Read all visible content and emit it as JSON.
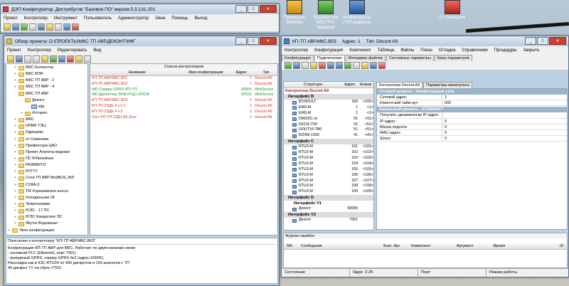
{
  "desktop": {
    "icons": [
      {
        "label": "Проводник Windows",
        "icon": "explorer-icon"
      },
      {
        "label": "Разработчик КИС ГРП-модемов",
        "icon": "modem-developer-icon"
      },
      {
        "label": "Конфигуратор ГРП-модемов",
        "icon": "modem-configurator-icon"
      },
      {
        "label": "С+ Наладчик",
        "icon": "tuner-app-icon"
      }
    ],
    "taskbar_icons": [
      "excel-icon",
      "network-icon",
      "mail-icon",
      "excel-2-icon"
    ]
  },
  "main_window": {
    "title": "ДЭП Конфигуратор. Дистрибутив \"Базовое ПО\" версии 5.5.131.201",
    "menu": [
      "Проект",
      "Контроллер",
      "Инструмент",
      "Пользователь",
      "Администратор",
      "Окна",
      "Помощь",
      "Выход"
    ]
  },
  "project_window": {
    "title": "Обзор проекта: D:\\ПРОЕКТЫ\\МКС ТП АВР.ДЕКОНТ\\КФГ",
    "menu": [
      "Проект",
      "Контроллер",
      "Редактировать",
      "Вид"
    ],
    "tree": [
      {
        "label": "МКС Коллектор",
        "depth": 1,
        "toggle": "+"
      },
      {
        "label": "МКС МЭК",
        "depth": 1,
        "toggle": "+"
      },
      {
        "label": "МКС ТП АВР - 2",
        "depth": 1,
        "toggle": "+"
      },
      {
        "label": "МКС ТП АВР - 4",
        "depth": 1,
        "toggle": "+"
      },
      {
        "label": "МКС ТП АВР",
        "depth": 1,
        "toggle": "-"
      },
      {
        "label": "Деконт",
        "depth": 2,
        "toggle": "-"
      },
      {
        "label": "кфг",
        "depth": 3,
        "toggle": ""
      },
      {
        "label": "История",
        "depth": 2,
        "toggle": "+"
      },
      {
        "label": "МКС",
        "depth": 1,
        "toggle": "+"
      },
      {
        "label": "НПМК ТЭЦ",
        "depth": 1,
        "toggle": "+"
      },
      {
        "label": "Одинцово",
        "depth": 1,
        "toggle": "+"
      },
      {
        "label": "от Семенова",
        "depth": 1,
        "toggle": "+"
      },
      {
        "label": "Префектура ЦАО",
        "depth": 1,
        "toggle": "+"
      },
      {
        "label": "Проект Апатиты водокан",
        "depth": 1,
        "toggle": "+"
      },
      {
        "label": "ПС Юбилейная",
        "depth": 1,
        "toggle": "+"
      },
      {
        "label": "РАЗМЕРГО",
        "depth": 1,
        "toggle": "+"
      },
      {
        "label": "РХТТУ",
        "depth": 1,
        "toggle": "+"
      },
      {
        "label": "Сочи ТП АВР ModBUS_МЭ",
        "depth": 1,
        "toggle": "+"
      },
      {
        "label": "СУФА-3",
        "depth": 1,
        "toggle": "+"
      },
      {
        "label": "ТМ Хорошевское шоссе",
        "depth": 1,
        "toggle": "+"
      },
      {
        "label": "Холодильник 18",
        "depth": 1,
        "toggle": "+"
      },
      {
        "label": "Энергосервис",
        "depth": 1,
        "toggle": "+"
      },
      {
        "label": "ЮЭС - 17 ПС",
        "depth": 1,
        "toggle": "+"
      },
      {
        "label": "ЮЭС Каширское ЭС",
        "depth": 1,
        "toggle": "+"
      },
      {
        "label": "Якутск Водоканал",
        "depth": 1,
        "toggle": "+"
      },
      {
        "label": "Экоп конфигурации",
        "depth": 0,
        "toggle": "+"
      }
    ],
    "list_caption": "Список контроллеров",
    "columns": [
      "Название",
      "Имя конфигурации",
      "Адрес",
      "Тип"
    ],
    "rows": [
      {
        "name": "КП-ТП АВР.МКС.В01",
        "config": "",
        "addr": "1",
        "type": "Decont A9",
        "color": "red"
      },
      {
        "name": "КП-ТП АВР.МКС.В02",
        "config": "",
        "addr": "1",
        "type": "Decont A9",
        "color": "red"
      },
      {
        "name": "WD Сервер GPRS КП+ТП",
        "config": "",
        "addr": "60005",
        "type": "WinDecont",
        "color": "green"
      },
      {
        "name": "WD Диспетчер МЭК+РЦС+КЗСМ",
        "config": "",
        "addr": "60101",
        "type": "WinDecont",
        "color": "green"
      },
      {
        "name": "КП-ТП АВР.МКС.В03",
        "config": "",
        "addr": "1",
        "type": "Decont A9",
        "color": "red"
      },
      {
        "name": "КП-ТП-2ЗДЕ.4 v.2.1",
        "config": "",
        "addr": "1",
        "type": "Decont A9",
        "color": "red"
      },
      {
        "name": "КП-ТП-2ЗДЕ.4 v.3",
        "config": "",
        "addr": "1",
        "type": "Decont A9",
        "color": "red"
      },
      {
        "name": "Тест КП-ТП-2ЗД1.В0.3ххх",
        "config": "",
        "addr": "1",
        "type": "Decont A9",
        "color": "red"
      }
    ],
    "notes_title": "Пояснения к контроллеру \"КП-ТП АВР.МКС.В03\"",
    "notes": [
      "Конфигурация КП-ТП АВР для МКС. Работает по двум каналам связи:",
      "- основной PLC (Ethernet), порт 7001)",
      "- резервный GPRS, сервер GPRS №2 (адрес 60005);",
      "Раскладка как в КЗС-RTU24 по 400 дискретов и 100 аналогов с ТП",
      "49 дискрет ТУ на сброс УТКЗ"
    ]
  },
  "controller_window": {
    "title": "КП-ТП АВР.МКС.В03",
    "address_label": "Адрес: 1",
    "type_label": "Тип: Decont A9",
    "menu": [
      "Контроллер",
      "Конфигурация",
      "Компонент",
      "Таблица",
      "Файлы",
      "Показ",
      "Отладка",
      "Справочники",
      "Процедуры",
      "Закрыть"
    ],
    "tabs": [
      "Конфигурация",
      "Подключение",
      "Менеджер файлов",
      "Системные параметры",
      "Базы параметров"
    ],
    "tree_columns": [
      "Структура",
      "Адрес",
      "Номер"
    ],
    "tree_root": "Контроллер Decont A9",
    "interfaces": [
      {
        "label": "Интерфейс B",
        "items": [
          {
            "name": "BOXPULT",
            "addr": "100",
            "num": "<100>"
          },
          {
            "name": "EM3-M",
            "addr": "1",
            "num": "<1>"
          },
          {
            "name": "EM3-M",
            "addr": "2",
            "num": "<2>"
          },
          {
            "name": "DIM16C-xx",
            "addr": "91",
            "num": "<91>"
          },
          {
            "name": "DIO16-T05",
            "addr": "52",
            "num": "<52>"
          },
          {
            "name": "DOUT16-TB0",
            "addr": "51",
            "num": "<51>"
          },
          {
            "name": "RZIN6-1000",
            "addr": "41",
            "num": "<41>"
          }
        ]
      },
      {
        "label": "Интерфейс C",
        "items": [
          {
            "name": "RTU3-M",
            "addr": "101",
            "num": "<101>"
          },
          {
            "name": "RTU3-M",
            "addr": "102",
            "num": "<102>"
          },
          {
            "name": "RTU3-M",
            "addr": "103",
            "num": "<103>"
          },
          {
            "name": "RTU3-M",
            "addr": "104",
            "num": "<104>"
          },
          {
            "name": "RTU3-M",
            "addr": "105",
            "num": "<105>"
          },
          {
            "name": "RTU3-M",
            "addr": "106",
            "num": "<106>"
          },
          {
            "name": "RTU3-M",
            "addr": "107",
            "num": "<107>"
          },
          {
            "name": "RTU3-M",
            "addr": "108",
            "num": "<108>"
          },
          {
            "name": "RTU3-M",
            "addr": "109",
            "num": "<109>"
          }
        ]
      },
      {
        "label": "Интерфейс D",
        "sub": "Интерфейс V1",
        "items": [
          {
            "name": "Деконт",
            "addr": "60005",
            "num": ""
          }
        ]
      },
      {
        "label": "Интерфейс V2",
        "items": [
          {
            "name": "Деконт",
            "addr": "7001",
            "num": ""
          }
        ]
      }
    ],
    "right_tabs": [
      "Контроллер Decont A9",
      "Параметры минипульта"
    ],
    "settings_header": "Сетевой уровень : Конфигурация узла",
    "settings": [
      {
        "key": "Сетевой адрес",
        "value": "1"
      },
      {
        "key": "Клиентский тайм-аут",
        "value": "600"
      }
    ],
    "channel_header": "Канальный уровень : ETHERNET",
    "channel": [
      {
        "key": "Получить динамически IP-адрес",
        "value": ""
      },
      {
        "key": "IP-адрес",
        "value": "0"
      },
      {
        "key": "Маска подсети",
        "value": "0"
      },
      {
        "key": "MAC-адрес",
        "value": "0"
      },
      {
        "key": "Шлюз",
        "value": "0"
      }
    ],
    "log_title": "Журнал ошибок",
    "log_columns": [
      "NN",
      "Сообщение",
      "Знач. Арг.",
      "Компонент",
      "Аргумент",
      "Время",
      "ID"
    ],
    "status": [
      "Состояние",
      "Ядро: 2.25",
      "Порт",
      "Режим работы"
    ]
  }
}
